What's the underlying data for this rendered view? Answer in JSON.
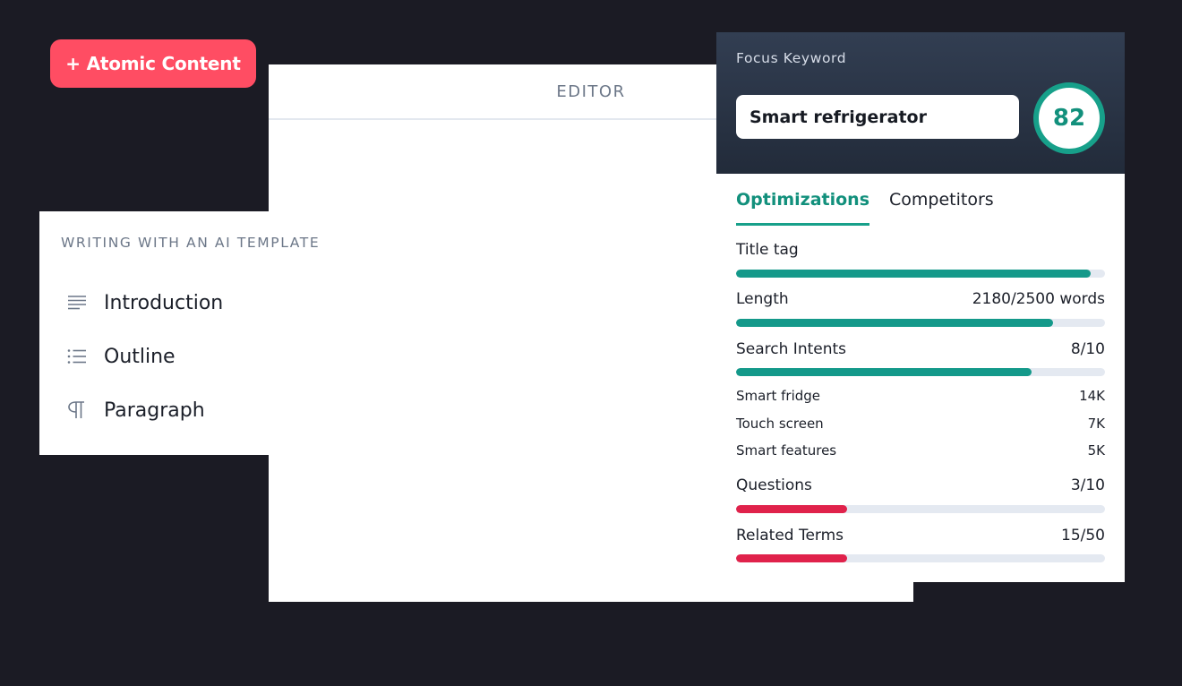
{
  "atomic_button": {
    "label": "+ Atomic Content"
  },
  "editor": {
    "header": "EDITOR"
  },
  "template": {
    "title": "WRITING WITH AN AI TEMPLATE",
    "items": [
      {
        "label": "Introduction",
        "icon": "align-left-icon"
      },
      {
        "label": "Outline",
        "icon": "list-icon"
      },
      {
        "label": "Paragraph",
        "icon": "pilcrow-icon"
      }
    ]
  },
  "seo": {
    "focus_label": "Focus Keyword",
    "focus_value": "Smart refrigerator",
    "score": "82",
    "tabs": [
      "Optimizations",
      "Competitors"
    ],
    "active_tab": "Optimizations",
    "metrics": {
      "title_tag": {
        "label": "Title tag",
        "value": "",
        "progress": 0.96
      },
      "length": {
        "label": "Length",
        "value": "2180/2500 words",
        "progress": 0.86
      },
      "search_intents": {
        "label": "Search Intents",
        "value": "8/10",
        "progress": 0.8
      },
      "questions": {
        "label": "Questions",
        "value": "3/10",
        "progress": 0.3
      },
      "related_terms": {
        "label": "Related Terms",
        "value": "15/50",
        "progress": 0.3
      }
    },
    "intents": [
      {
        "label": "Smart fridge",
        "value": "14K"
      },
      {
        "label": "Touch screen",
        "value": "7K"
      },
      {
        "label": "Smart features",
        "value": "5K"
      }
    ]
  },
  "colors": {
    "accent_green": "#14998a",
    "accent_red": "#e0224b",
    "button_red": "#ff4d63",
    "background": "#1b1b24"
  }
}
